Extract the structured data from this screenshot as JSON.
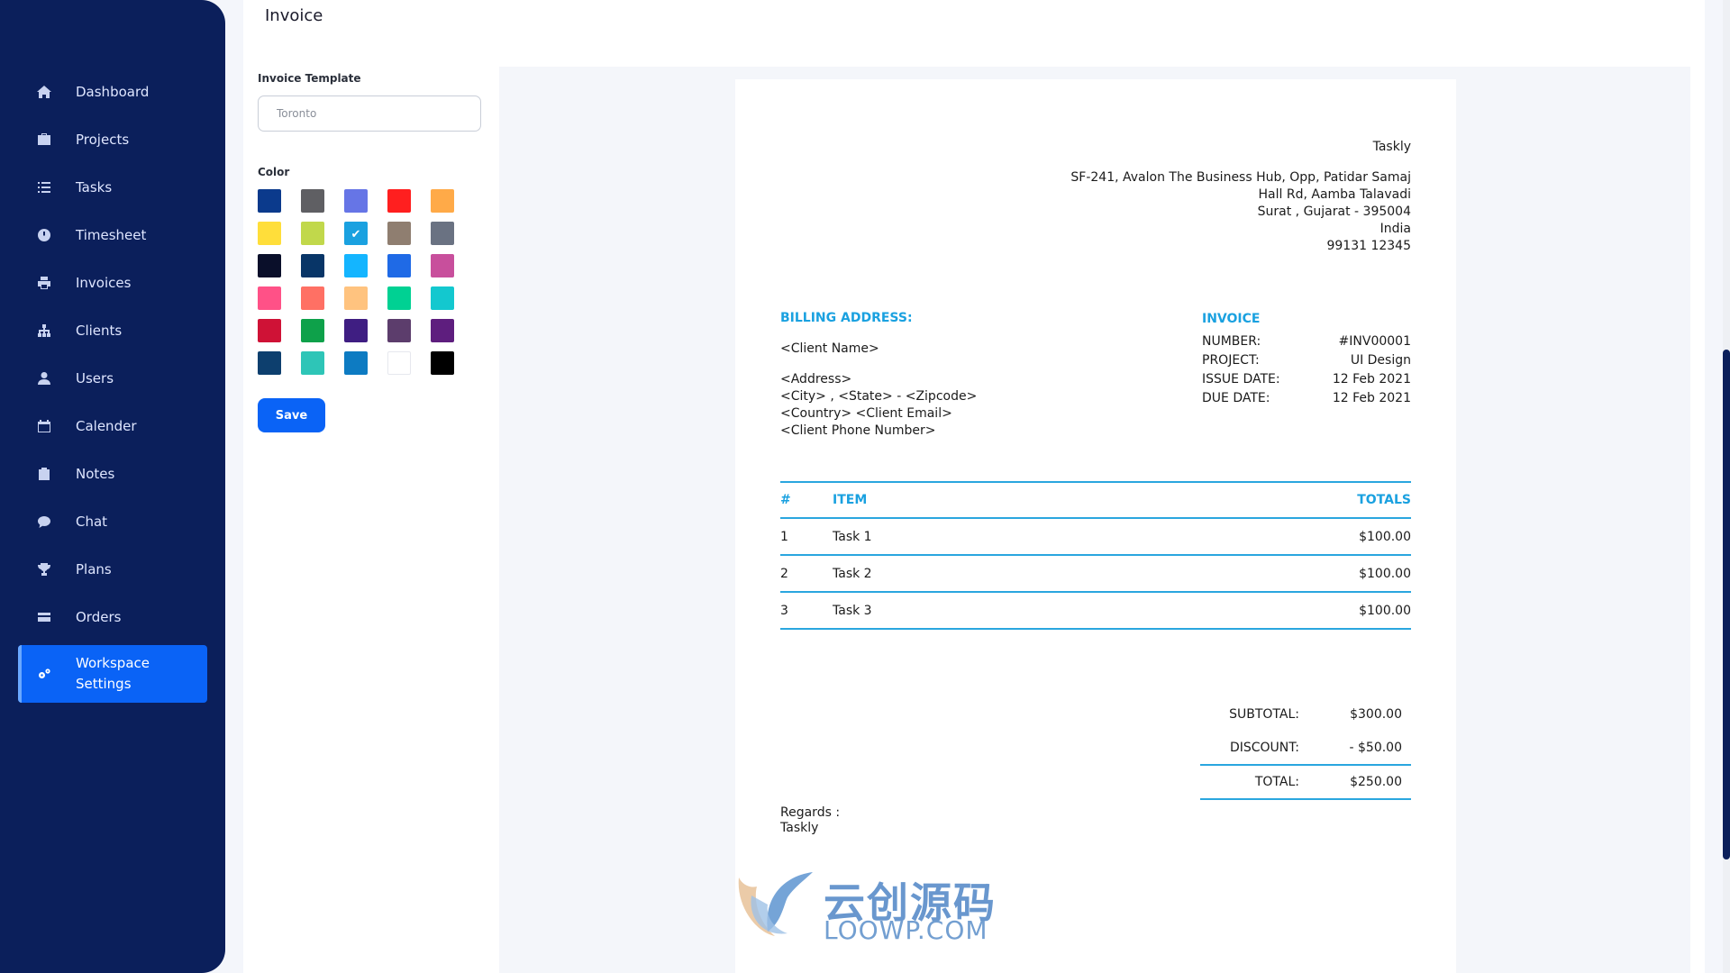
{
  "header": {
    "title": "Invoice"
  },
  "sidebar": {
    "items": [
      {
        "label": "Dashboard",
        "icon": "home-icon"
      },
      {
        "label": "Projects",
        "icon": "briefcase-icon"
      },
      {
        "label": "Tasks",
        "icon": "list-icon"
      },
      {
        "label": "Timesheet",
        "icon": "clock-icon"
      },
      {
        "label": "Invoices",
        "icon": "printer-icon"
      },
      {
        "label": "Clients",
        "icon": "sitemap-icon"
      },
      {
        "label": "Users",
        "icon": "user-icon"
      },
      {
        "label": "Calender",
        "icon": "calendar-icon"
      },
      {
        "label": "Notes",
        "icon": "clipboard-icon"
      },
      {
        "label": "Chat",
        "icon": "chat-icon"
      },
      {
        "label": "Plans",
        "icon": "trophy-icon"
      },
      {
        "label": "Orders",
        "icon": "credit-card-icon"
      },
      {
        "label": "Workspace\nSettings",
        "icon": "gears-icon",
        "active": true
      }
    ]
  },
  "settings": {
    "template_label": "Invoice Template",
    "template_value": "Toronto",
    "color_label": "Color",
    "colors": [
      "#0b3a8c",
      "#5f5f63",
      "#6675e6",
      "#ff1f1f",
      "#ffaa48",
      "#ffde3a",
      "#c1d84b",
      "#1aa1e0",
      "#8f7e70",
      "#6a7282",
      "#0a0f2a",
      "#083567",
      "#14b5ff",
      "#1f6ae6",
      "#c84f9c",
      "#ff5187",
      "#ff7064",
      "#ffc37f",
      "#00d193",
      "#13c8cf",
      "#cf1236",
      "#0ea14a",
      "#3f1e82",
      "#5c3d6c",
      "#5e1e7e",
      "#0d3f6e",
      "#2ec5b7",
      "#0d7bc2",
      "#ffffff",
      "#000000"
    ],
    "selected_color_index": 7,
    "save_label": "Save"
  },
  "invoice": {
    "company_name": "Taskly",
    "company_address": [
      "SF-241, Avalon The Business Hub, Opp, Patidar Samaj",
      "Hall Rd, Aamba Talavadi",
      "Surat , Gujarat - 395004",
      "India",
      "99131 12345"
    ],
    "billing_title": "BILLING ADDRESS:",
    "client_name": "<Client Name>",
    "client_address": [
      "<Address>",
      "<City> , <State> - <Zipcode>",
      "<Country> <Client Email>",
      "<Client Phone Number>"
    ],
    "invoice_title": "INVOICE",
    "meta": [
      {
        "k": "NUMBER:",
        "v": "#INV00001"
      },
      {
        "k": "PROJECT:",
        "v": "UI Design"
      },
      {
        "k": "ISSUE DATE:",
        "v": "12 Feb 2021"
      },
      {
        "k": "DUE DATE:",
        "v": "12 Feb 2021"
      }
    ],
    "table_head": {
      "num": "#",
      "item": "ITEM",
      "total": "TOTALS"
    },
    "items": [
      {
        "num": "1",
        "item": "Task 1",
        "total": "$100.00"
      },
      {
        "num": "2",
        "item": "Task 2",
        "total": "$100.00"
      },
      {
        "num": "3",
        "item": "Task 3",
        "total": "$100.00"
      }
    ],
    "subtotal_label": "SUBTOTAL:",
    "subtotal_value": "$300.00",
    "discount_label": "DISCOUNT:",
    "discount_value": "- $50.00",
    "total_label": "TOTAL:",
    "total_value": "$250.00",
    "regards": "Regards :",
    "regards_name": "Taskly"
  },
  "watermark": {
    "cn": "云创源码",
    "en": "LOOWP.COM"
  },
  "colors": {
    "sidebar_bg": "#0b1f5b",
    "accent": "#0a63f6",
    "invoice_accent": "#1aa1e0"
  }
}
